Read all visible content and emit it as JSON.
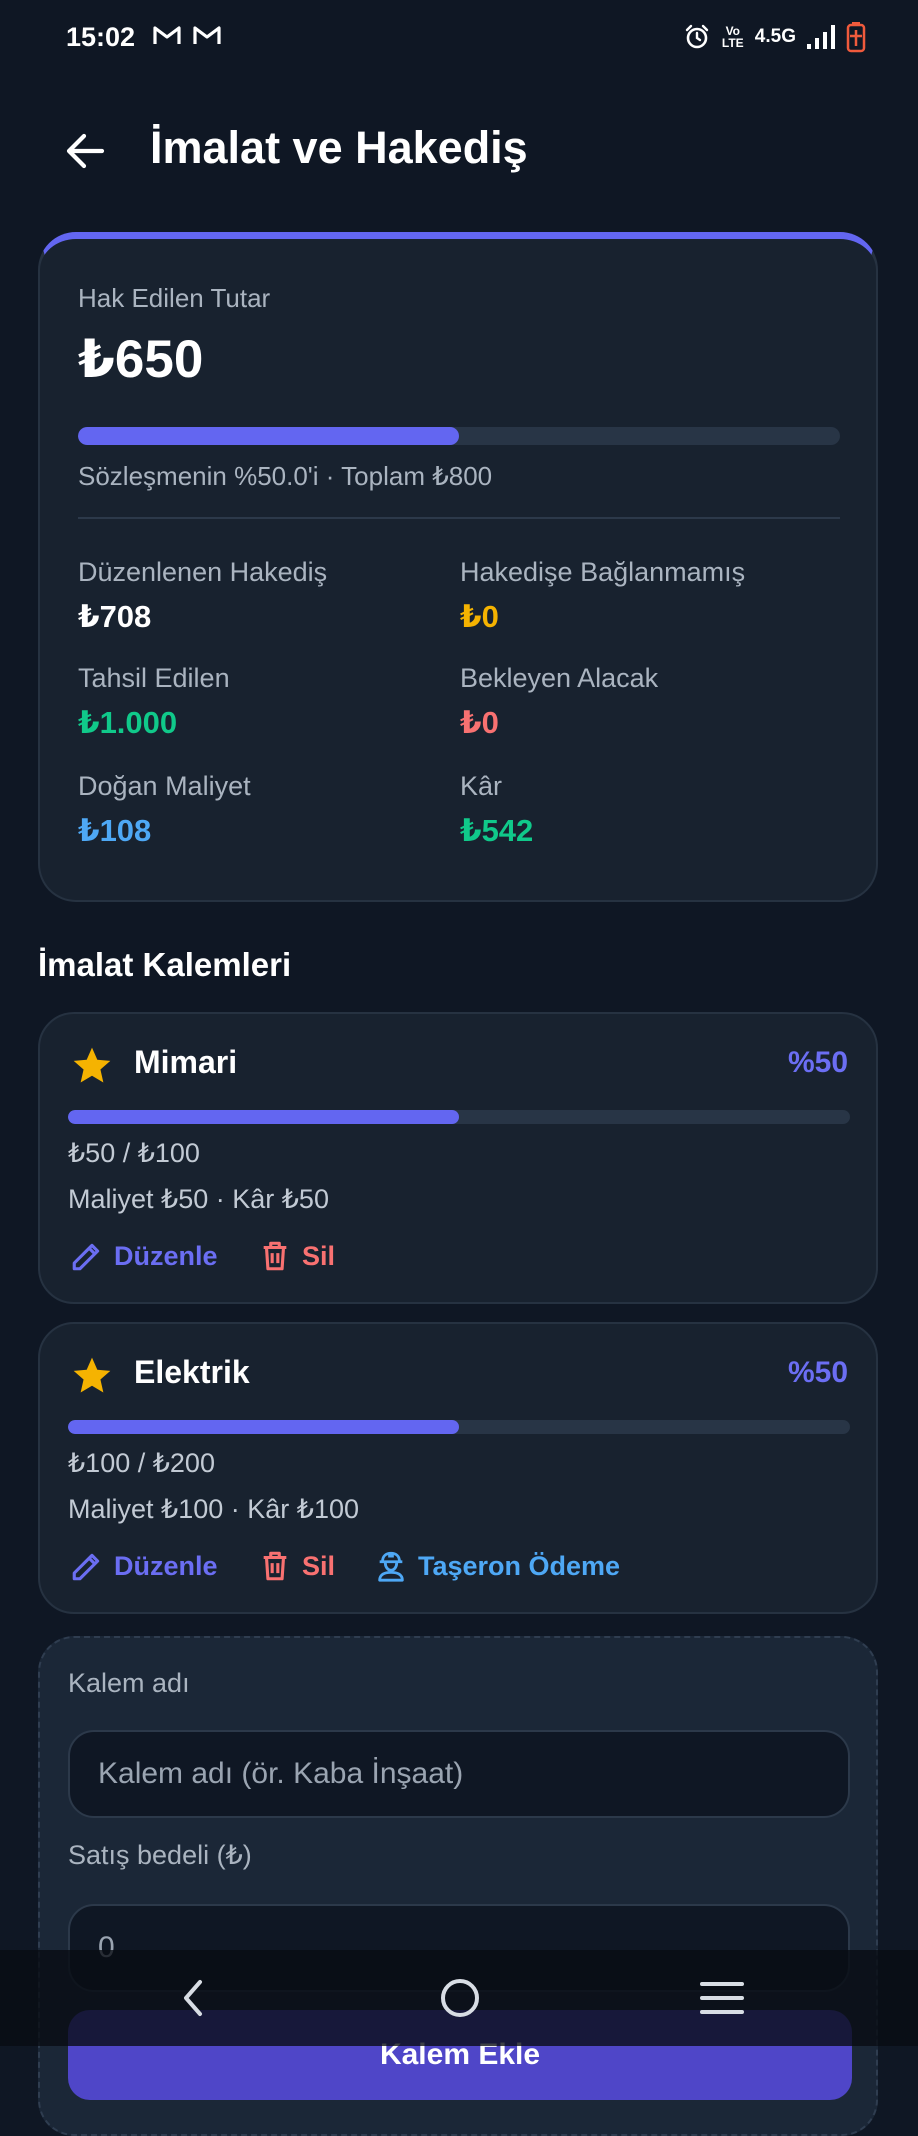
{
  "status_bar": {
    "time": "15:02",
    "volte": "Vo LTE",
    "network": "4.5G"
  },
  "header": {
    "title": "İmalat ve Hakediş"
  },
  "summary": {
    "earned_label": "Hak Edilen Tutar",
    "earned_amount": "₺650",
    "progress_percent": 50,
    "progress_text": "Sözleşmenin %50.0'i · Toplam ₺800",
    "stats": {
      "issued_label": "Düzenlenen Hakediş",
      "issued_value": "₺708",
      "unlinked_label": "Hakedişe Bağlanmamış",
      "unlinked_value": "₺0",
      "collected_label": "Tahsil Edilen",
      "collected_value": "₺1.000",
      "pending_label": "Bekleyen Alacak",
      "pending_value": "₺0",
      "cost_label": "Doğan Maliyet",
      "cost_value": "₺108",
      "profit_label": "Kâr",
      "profit_value": "₺542"
    }
  },
  "items_section": {
    "title": "İmalat Kalemleri"
  },
  "items": [
    {
      "name": "Mimari",
      "percent_label": "%50",
      "progress_percent": 50,
      "amount_line": "₺50 / ₺100",
      "cost_line": "Maliyet ₺50 · Kâr ₺50",
      "edit_label": "Düzenle",
      "delete_label": "Sil"
    },
    {
      "name": "Elektrik",
      "percent_label": "%50",
      "progress_percent": 50,
      "amount_line": "₺100 / ₺200",
      "cost_line": "Maliyet ₺100 · Kâr ₺100",
      "edit_label": "Düzenle",
      "delete_label": "Sil",
      "subcontractor_label": "Taşeron Ödeme"
    }
  ],
  "form": {
    "name_label": "Kalem adı",
    "name_placeholder": "Kalem adı (ör. Kaba İnşaat)",
    "price_label": "Satış bedeli (₺)",
    "price_placeholder": "0",
    "add_button_label": "Kalem Ekle"
  },
  "colors": {
    "accent": "#6366f1",
    "amber": "#f5b301",
    "green": "#10c98a",
    "red": "#f87171",
    "blue": "#4ea8f5"
  }
}
